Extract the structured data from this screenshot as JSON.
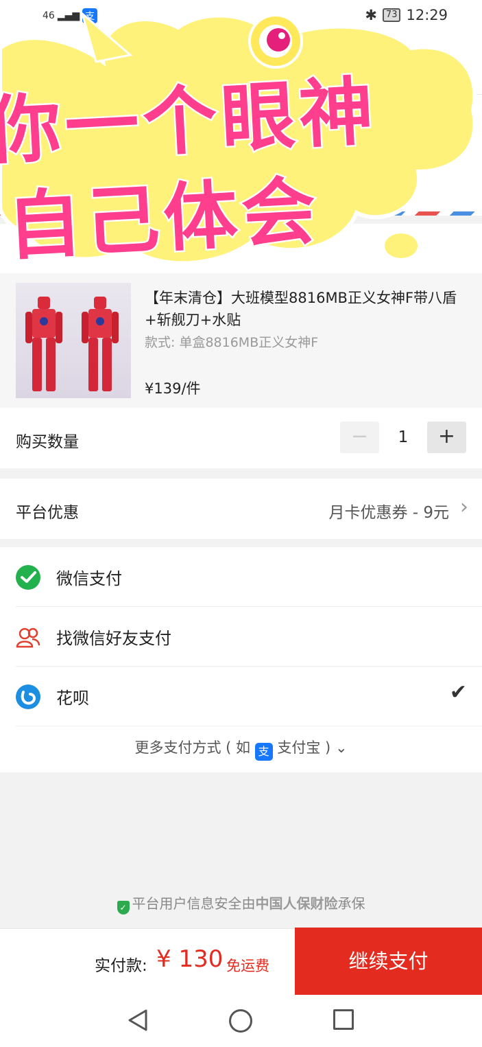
{
  "status_bar": {
    "network": "46",
    "battery": "73",
    "time": "12:29",
    "alipay_icon_char": "支"
  },
  "meme_overlay": {
    "line1": "你一个眼神",
    "line2": "自己体会"
  },
  "product": {
    "title": "【年末清仓】大班模型8816MB正义女神F带八盾+斩舰刀+水贴",
    "style": "款式: 单盒8816MB正义女神F",
    "price": "¥139/件"
  },
  "quantity": {
    "label": "购买数量",
    "minus": "−",
    "value": "1",
    "plus": "+"
  },
  "promotion": {
    "label": "平台优惠",
    "value": "月卡优惠券 - 9元"
  },
  "payment_methods": [
    {
      "label": "微信支付",
      "icon": "wechat-pay-icon",
      "selected": false
    },
    {
      "label": "找微信好友支付",
      "icon": "friends-icon",
      "selected": false
    },
    {
      "label": "花呗",
      "icon": "huabei-icon",
      "selected": true
    }
  ],
  "more_payment": {
    "prefix": "更多支付方式 ( 如",
    "alipay_char": "支",
    "suffix": "支付宝 )"
  },
  "security": {
    "prefix": "平台用户信息安全由",
    "insurer": "中国人保财险",
    "suffix": "承保"
  },
  "checkout": {
    "label": "实付款:",
    "amount": "¥ 130",
    "shipping": "免运费",
    "button": "继续支付"
  },
  "colors": {
    "accent": "#e32b20",
    "meme_pink": "#ff3f8d",
    "meme_yellow": "#fff27a"
  }
}
